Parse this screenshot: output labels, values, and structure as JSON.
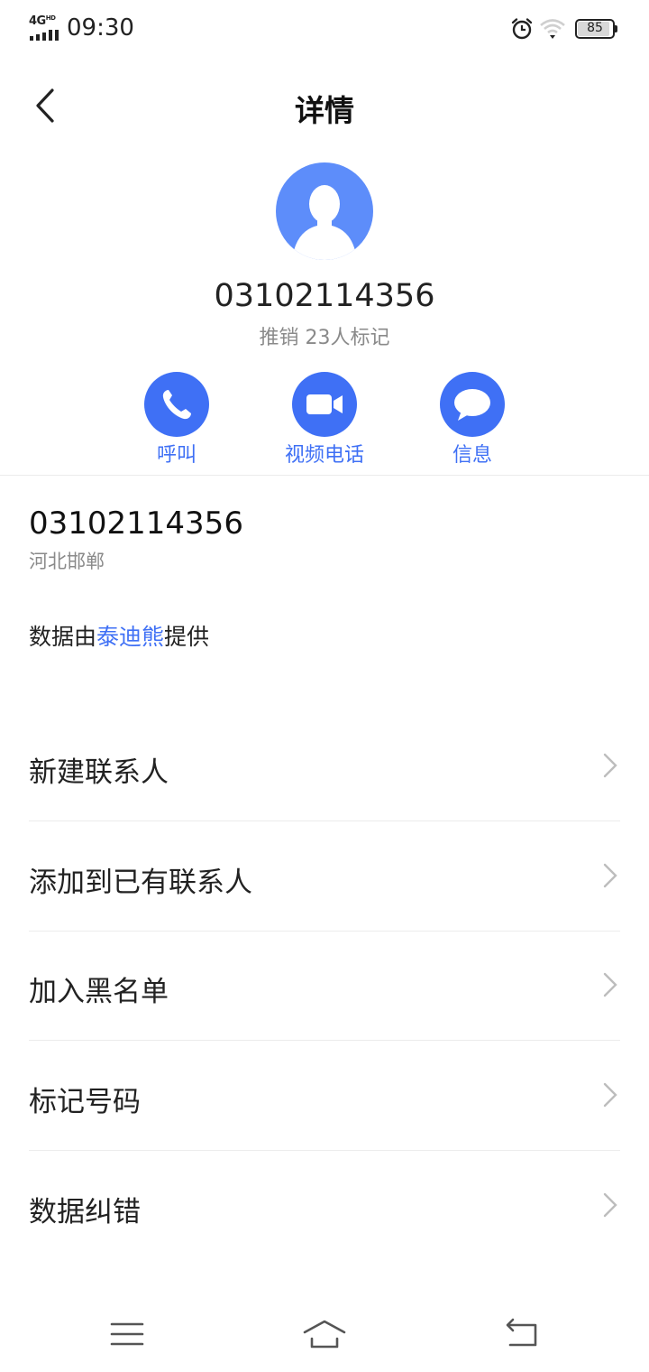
{
  "status_bar": {
    "network": "4G",
    "network_sup": "HD",
    "time": "09:30",
    "battery": "85",
    "icons": [
      "signal-icon",
      "alarm-icon",
      "wifi-icon",
      "battery-icon"
    ]
  },
  "header": {
    "title": "详情",
    "back_icon": "back-arrow-icon"
  },
  "caller": {
    "avatar_icon": "person-avatar-icon",
    "number": "03102114356",
    "tag": "推销 23人标记"
  },
  "actions": [
    {
      "label": "呼叫",
      "icon": "phone-icon"
    },
    {
      "label": "视频电话",
      "icon": "video-camera-icon"
    },
    {
      "label": "信息",
      "icon": "message-bubble-icon"
    }
  ],
  "info": {
    "number": "03102114356",
    "location": "河北邯郸",
    "provider_prefix": "数据由",
    "provider_name": "泰迪熊",
    "provider_suffix": "提供"
  },
  "menu": [
    {
      "label": "新建联系人"
    },
    {
      "label": "添加到已有联系人"
    },
    {
      "label": "加入黑名单"
    },
    {
      "label": "标记号码"
    },
    {
      "label": "数据纠错"
    }
  ],
  "nav_bar": {
    "icons": [
      "menu-icon",
      "home-icon",
      "back-icon"
    ]
  },
  "colors": {
    "accent": "#3f70f5",
    "avatar_bg": "#5d8dfa",
    "secondary_text": "#8a8a8a"
  }
}
